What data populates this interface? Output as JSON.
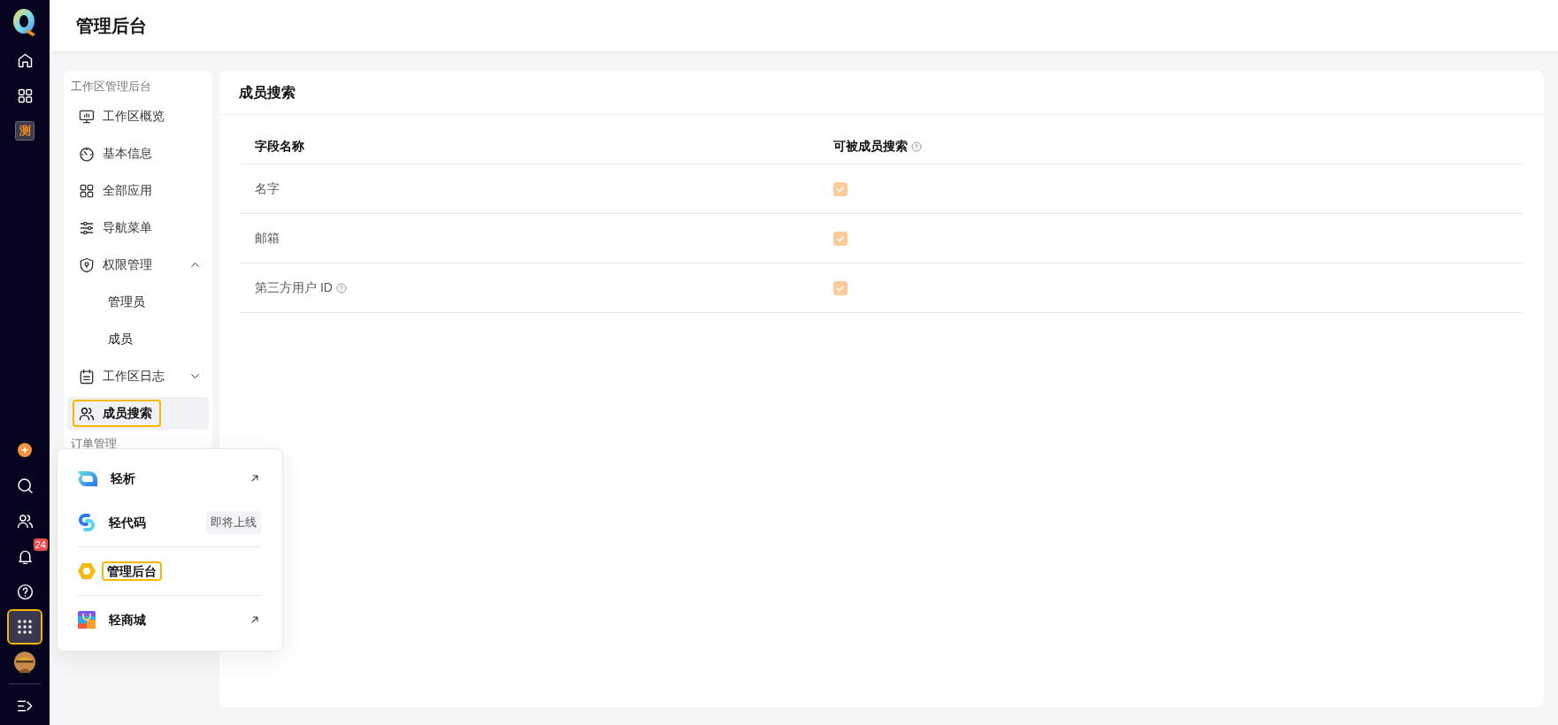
{
  "rail": {
    "top_items": [
      {
        "kind": "logo"
      },
      {
        "kind": "home"
      },
      {
        "kind": "apps"
      },
      {
        "kind": "text",
        "label": "测"
      }
    ],
    "bottom_items": [
      {
        "kind": "add",
        "highlighted": false
      },
      {
        "kind": "search",
        "highlighted": false
      },
      {
        "kind": "members",
        "highlighted": false
      },
      {
        "kind": "bell",
        "badge": "24",
        "highlighted": false
      },
      {
        "kind": "help",
        "highlighted": false
      },
      {
        "kind": "launcher",
        "highlighted": true
      },
      {
        "kind": "avatar",
        "highlighted": false
      },
      {
        "kind": "collapse",
        "highlighted": false
      }
    ]
  },
  "header": {
    "title": "管理后台"
  },
  "sidebar": {
    "title": "工作区管理后台",
    "items": [
      {
        "label": "工作区概览",
        "selected": false,
        "highlighted": false
      },
      {
        "label": "基本信息",
        "selected": false,
        "highlighted": false
      },
      {
        "label": "全部应用",
        "selected": false,
        "highlighted": false
      },
      {
        "label": "导航菜单",
        "selected": false,
        "highlighted": false
      },
      {
        "label": "权限管理",
        "selected": false,
        "highlighted": false,
        "expanded": true,
        "children": [
          {
            "label": "管理员",
            "selected": false
          },
          {
            "label": "成员",
            "selected": false
          }
        ]
      },
      {
        "label": "工作区日志",
        "selected": false,
        "highlighted": false,
        "expanded": false
      },
      {
        "label": "成员搜索",
        "selected": true,
        "highlighted": true
      }
    ],
    "next_section": "订单管理"
  },
  "main": {
    "title": "成员搜索",
    "table": {
      "columns": [
        {
          "label": "字段名称",
          "help": false
        },
        {
          "label": "可被成员搜索",
          "help": true
        }
      ],
      "rows": [
        {
          "name": "名字",
          "help": false,
          "checked": true,
          "disabled": true
        },
        {
          "name": "邮箱",
          "help": false,
          "checked": true,
          "disabled": true
        },
        {
          "name": "第三方用户 ID",
          "help": true,
          "checked": true,
          "disabled": true
        }
      ]
    }
  },
  "app_menu": {
    "groups": [
      [
        {
          "label": "轻析",
          "external": true,
          "highlighted": false
        },
        {
          "label": "轻代码",
          "tag": "即将上线",
          "external": false,
          "highlighted": false
        }
      ],
      [
        {
          "label": "管理后台",
          "external": false,
          "highlighted": true
        }
      ],
      [
        {
          "label": "轻商城",
          "external": true,
          "highlighted": false
        }
      ]
    ]
  }
}
